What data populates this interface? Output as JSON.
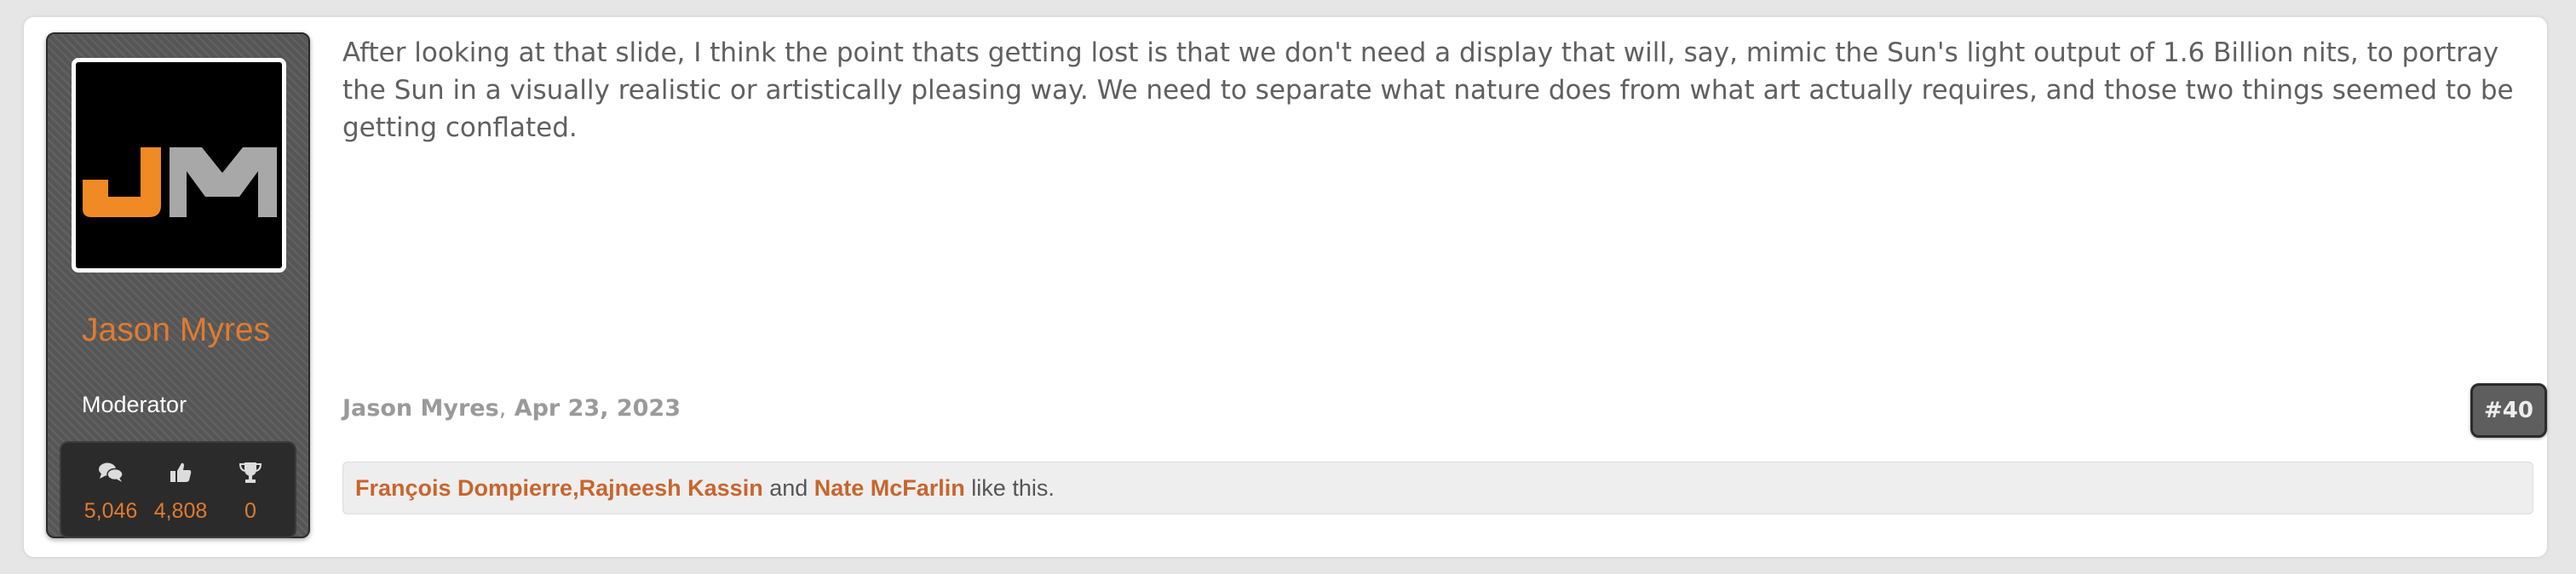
{
  "user": {
    "name": "Jason Myres",
    "title": "Moderator",
    "avatar_logo_text": "JM",
    "stats": [
      {
        "icon": "messages-icon",
        "value": "5,046"
      },
      {
        "icon": "thumbs-up-icon",
        "value": "4,808"
      },
      {
        "icon": "trophy-icon",
        "value": "0"
      }
    ]
  },
  "post": {
    "message": "After looking at that slide, I think the point thats getting lost is that we don't need a display that will, say, mimic the Sun's light output of 1.6 Billion nits, to portray the Sun in a visually realistic or artistically pleasing way. We need to separate what nature does from what art actually requires, and those two things seemed to be getting conflated.",
    "author": "Jason Myres",
    "date": "Apr 23, 2023",
    "number": "#40"
  },
  "likes": {
    "users": [
      "François Dompierre",
      "Rajneesh Kassin",
      "Nate McFarlin"
    ],
    "comma": ",",
    "and_text": " and ",
    "suffix": " like this."
  },
  "colors": {
    "accent": "#e07b30",
    "link": "#c8652d",
    "panel": "#565656",
    "logo_orange": "#f08a24",
    "logo_gray": "#a8a8a8"
  }
}
